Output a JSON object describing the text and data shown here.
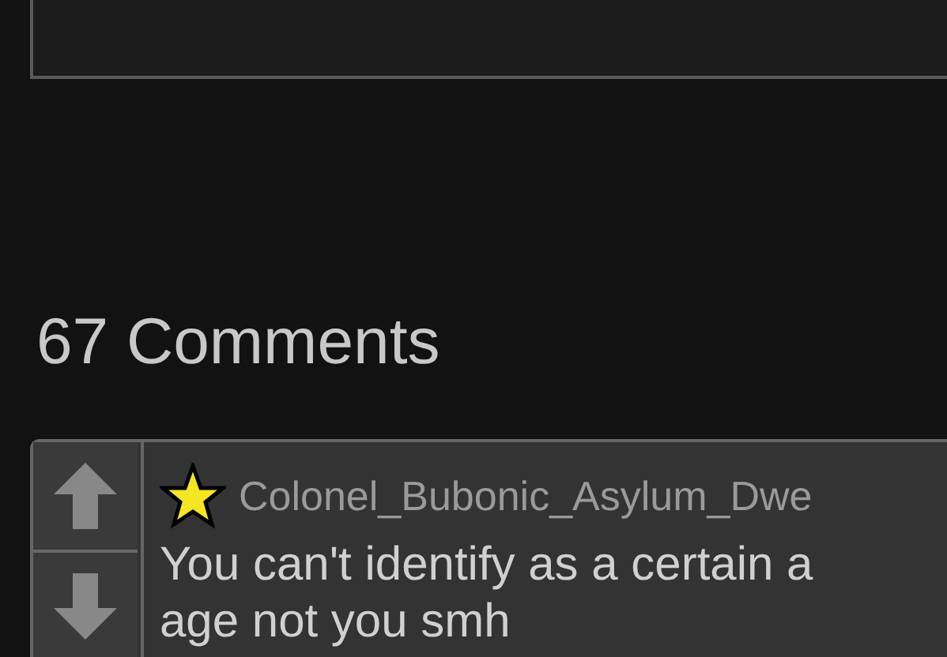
{
  "comments_heading": "67 Comments",
  "comment": {
    "username": "Colonel_Bubonic_Asylum_Dwe",
    "lines": [
      "You can't identify as a certain a",
      "age not you smh"
    ]
  }
}
